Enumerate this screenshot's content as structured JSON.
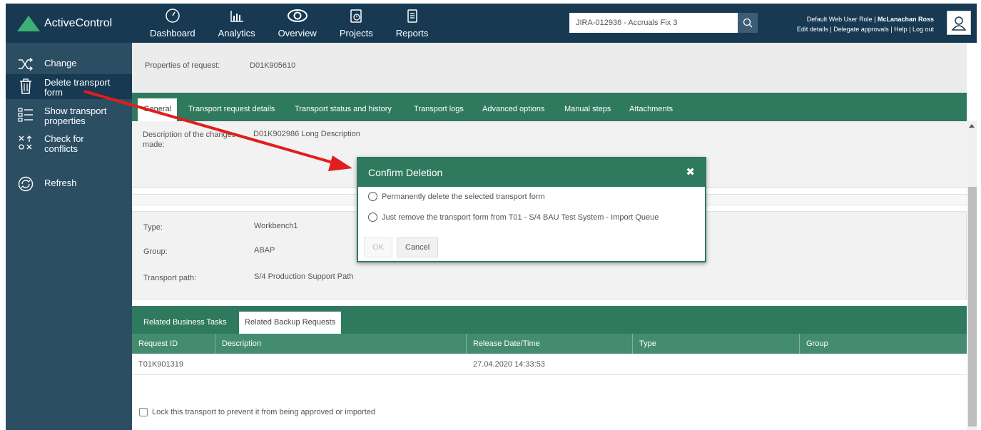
{
  "app": {
    "logo_text": "ActiveControl"
  },
  "nav": {
    "items": [
      {
        "label": "Dashboard",
        "icon": "gauge-icon"
      },
      {
        "label": "Analytics",
        "icon": "chart-icon"
      },
      {
        "label": "Overview",
        "icon": "eye-icon"
      },
      {
        "label": "Projects",
        "icon": "projects-icon"
      },
      {
        "label": "Reports",
        "icon": "report-icon"
      }
    ]
  },
  "search": {
    "value": "JIRA-012936 - Accruals Fix 3"
  },
  "user": {
    "role_prefix": "Default Web User Role | ",
    "name": "McLanachan Ross",
    "links": [
      "Edit details",
      "Delegate approvals",
      "Help",
      "Log out"
    ],
    "sep": " | "
  },
  "sidebar": {
    "items": [
      {
        "label": "Change",
        "icon": "shuffle-icon"
      },
      {
        "label": "Delete transport form",
        "icon": "trash-icon"
      },
      {
        "label": "Show transport properties",
        "icon": "list-icon"
      },
      {
        "label": "Check for conflicts",
        "icon": "conflict-icon"
      },
      {
        "label": "Refresh",
        "icon": "refresh-icon"
      }
    ]
  },
  "properties": {
    "label": "Properties of request:",
    "value": "D01K905610"
  },
  "tabs": [
    "General",
    "Transport request details",
    "Transport status and history",
    "Transport logs",
    "Advanced options",
    "Manual steps",
    "Attachments"
  ],
  "description": {
    "label": "Description of the changes made:",
    "value": "D01K902986 Long Description"
  },
  "info": {
    "type_label": "Type:",
    "type_value": "Workbench1",
    "group_label": "Group:",
    "group_value": "ABAP",
    "path_label": "Transport path:",
    "path_value": "S/4 Production Support Path"
  },
  "related_tabs": [
    "Related Business Tasks",
    "Related Backup Requests"
  ],
  "table": {
    "headers": [
      "Request ID",
      "Description",
      "Release Date/Time",
      "Type",
      "Group"
    ],
    "rows": [
      [
        "T01K901319",
        "",
        "27.04.2020 14:33:53",
        "",
        ""
      ]
    ]
  },
  "lock": {
    "label": "Lock this transport to prevent it from being approved or imported"
  },
  "modal": {
    "title": "Confirm Deletion",
    "option1": "Permanently delete the selected transport form",
    "option2": "Just remove the transport form from T01 - S/4 BAU Test System - Import Queue",
    "ok": "OK",
    "cancel": "Cancel"
  },
  "colors": {
    "header_bg": "#173a52",
    "sidebar_bg": "#2c4e63",
    "accent_green": "#2f7a5f",
    "logo_green": "#3bb273",
    "annotation_red": "#e01e1e"
  }
}
